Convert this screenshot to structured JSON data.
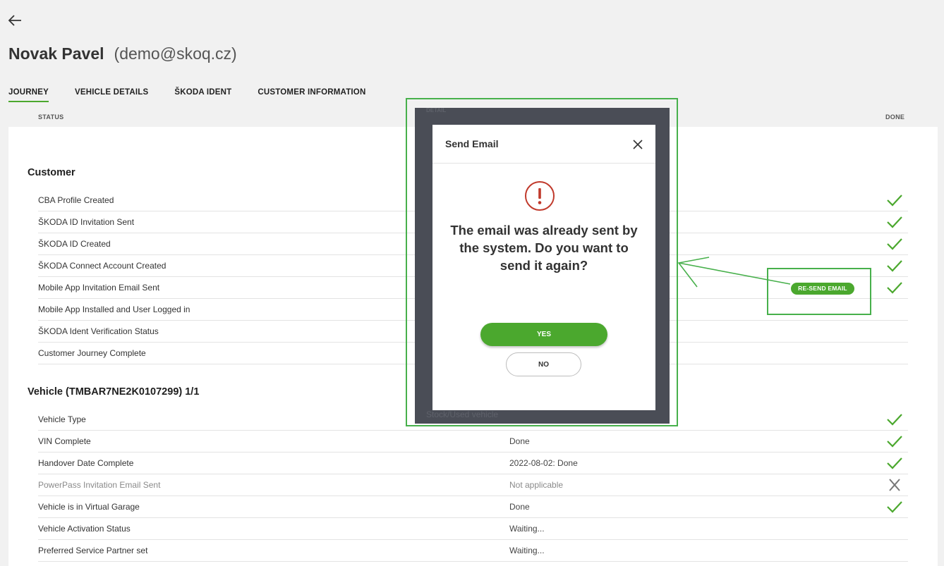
{
  "header": {
    "name": "Novak Pavel",
    "email": "(demo@skoq.cz)"
  },
  "tabs": [
    {
      "label": "JOURNEY",
      "active": true
    },
    {
      "label": "VEHICLE DETAILS",
      "active": false
    },
    {
      "label": "ŠKODA IDENT",
      "active": false
    },
    {
      "label": "CUSTOMER INFORMATION",
      "active": false
    }
  ],
  "columns": {
    "status": "STATUS",
    "detail": "DETAIL",
    "done": "DONE"
  },
  "customer": {
    "title": "Customer",
    "rows": [
      {
        "label": "CBA Profile Created",
        "detail": "",
        "status": "check-icon"
      },
      {
        "label": "ŠKODA ID Invitation Sent",
        "detail": "",
        "status": "check-icon"
      },
      {
        "label": "ŠKODA ID Created",
        "detail": "",
        "status": "check-icon"
      },
      {
        "label": "ŠKODA Connect Account Created",
        "detail": "",
        "status": "check-icon"
      },
      {
        "label": "Mobile App Invitation Email Sent",
        "detail": "",
        "status": "check-icon"
      },
      {
        "label": "Mobile App Installed and User Logged in",
        "detail": "",
        "status": ""
      },
      {
        "label": "ŠKODA Ident Verification Status",
        "detail": "",
        "status": ""
      },
      {
        "label": "Customer Journey Complete",
        "detail": "",
        "status": ""
      }
    ]
  },
  "vehicle": {
    "title": "Vehicle (TMBAR7NE2K0107299) 1/1",
    "rows": [
      {
        "label": "Vehicle Type",
        "detail": "",
        "status": "check-icon"
      },
      {
        "label": "VIN Complete",
        "detail": "Done",
        "status": "check-icon"
      },
      {
        "label": "Handover Date Complete",
        "detail": "2022-08-02: Done",
        "status": "check-icon"
      },
      {
        "label": "PowerPass Invitation Email Sent",
        "detail": "Not applicable",
        "status": "cross-icon",
        "muted": true
      },
      {
        "label": "Vehicle is in Virtual Garage",
        "detail": "Done",
        "status": "check-icon"
      },
      {
        "label": "Vehicle Activation Status",
        "detail": "Waiting...",
        "status": ""
      },
      {
        "label": "Preferred Service Partner set",
        "detail": "Waiting...",
        "status": ""
      }
    ]
  },
  "resend_button": "RE-SEND EMAIL",
  "overlay_hints": {
    "vehicle_type_detail": "Stock/Used vehicle"
  },
  "modal": {
    "title": "Send Email",
    "icon": "exclamation-circle-icon",
    "message": "The email was already sent by the system. Do you want to send it again?",
    "yes_label": "YES",
    "no_label": "NO"
  },
  "colors": {
    "accent": "#4ba82e",
    "annotation": "#47b04b",
    "warning": "#c0392b",
    "overlay": "#4a4d56"
  }
}
